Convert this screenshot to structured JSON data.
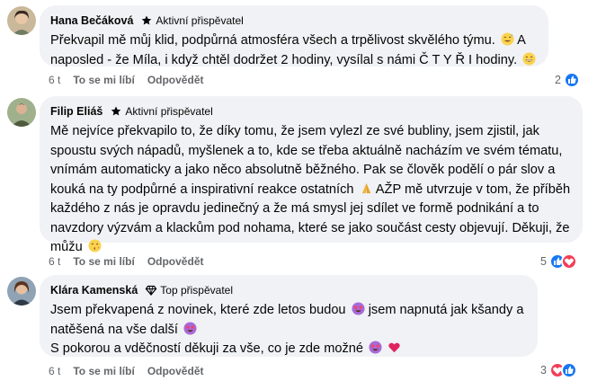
{
  "comments": [
    {
      "author": "Hana Bečáková",
      "badge": "Aktivní přispěvatel",
      "badge_icon": "star-icon",
      "lines": [
        "Překvapil mě můj klid, podpůrná atmosféra všech a trpělivost skvělého týmu.",
        "A naposled - že Míla, i když chtěl dodržet 2 hodiny, vysílal s námi Č T Y Ř I hodiny."
      ],
      "time": "6 t",
      "like_label": "To se mi líbí",
      "reply_label": "Odpovědět",
      "reaction_count": "2",
      "reaction_icons": [
        "like-icon"
      ]
    },
    {
      "author": "Filip Eliáš",
      "badge": "Aktivní přispěvatel",
      "badge_icon": "star-icon",
      "lines": [
        "Mě nejvíce překvapilo to, že díky tomu, že jsem vylezl ze své bubliny, jsem zjistil, jak spoustu svých nápadů, myšlenek a to, kde se třeba aktuálně nacházím ve svém tématu, vnímám automaticky a jako něco absolutně běžného. Pak se člověk podělí o pár slov a kouká na ty podpůrné a inspirativní reakce ostatních",
        "AŽP mě utvrzuje v tom, že příběh každého z nás je opravdu jedinečný a že má smysl jej sdílet ve formě podnikání a to navzdory výzvám a klackům pod nohama, které se jako součást cesty objevují. Děkuji, že můžu"
      ],
      "time": "6 t",
      "like_label": "To se mi líbí",
      "reply_label": "Odpovědět",
      "reaction_count": "5",
      "reaction_icons": [
        "like-icon",
        "love-icon"
      ]
    },
    {
      "author": "Klára Kamenská",
      "badge": "Top přispěvatel",
      "badge_icon": "diamond-icon",
      "lines": [
        "Jsem překvapená z novinek, které zde letos budou",
        "jsem napnutá jak kšandy a natěšená na vše další",
        "S pokorou a vděčností děkuji za vše, co je zde možné"
      ],
      "time": "6 t",
      "like_label": "To se mi líbí",
      "reply_label": "Odpovědět",
      "reaction_count": "3",
      "reaction_icons": [
        "love-icon",
        "like-icon"
      ]
    }
  ],
  "colors": {
    "bubble": "#f0f2f5",
    "like": "#1877f2",
    "love": "#f33e58",
    "meta": "#65676b",
    "emoji": "#fbd24d"
  }
}
